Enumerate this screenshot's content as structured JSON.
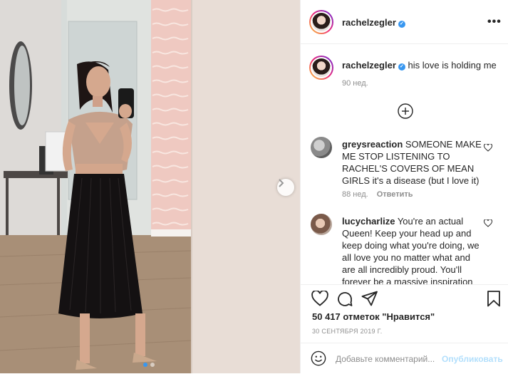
{
  "post": {
    "author": "rachelzegler",
    "verified_icon": "verified-badge-icon",
    "more_label": "•••"
  },
  "caption": {
    "username": "rachelzegler",
    "text": "his love is holding me",
    "time": "90 нед."
  },
  "comments": [
    {
      "username": "greysreaction",
      "text": "SOMEONE MAKE ME STOP LISTENING TO RACHEL'S COVERS OF MEAN GIRLS it's a disease (but I love it)",
      "line1": "SOMEONE MAKE",
      "line2": "ME STOP LISTENING TO",
      "line3": "RACHEL'S COVERS OF MEAN",
      "line4": "GIRLS it's a disease (but I love it)",
      "time": "88 нед.",
      "reply_label": "Ответить"
    },
    {
      "username": "lucycharlize",
      "line1": "You're an actual",
      "line2": "Queen! Keep your head up and",
      "line3": "keep doing what you're doing, we",
      "line4": "all love you no matter what and",
      "line5": "are all incredibly proud. You'll",
      "line6": "forever be a massive inspiration"
    }
  ],
  "engagement": {
    "likes": "50 417 отметок \"Нравится\"",
    "date": "30 СЕНТЯБРЯ 2019 Г."
  },
  "comment_box": {
    "placeholder": "Добавьте комментарий...",
    "publish_label": "Опубликовать"
  },
  "carousel": {
    "slides": 2,
    "active_index": 0
  },
  "colors": {
    "accent": "#3897f0",
    "text": "#262626",
    "muted": "#8e8e8e",
    "publish_disabled": "#b2dffc",
    "border": "#efefef"
  }
}
